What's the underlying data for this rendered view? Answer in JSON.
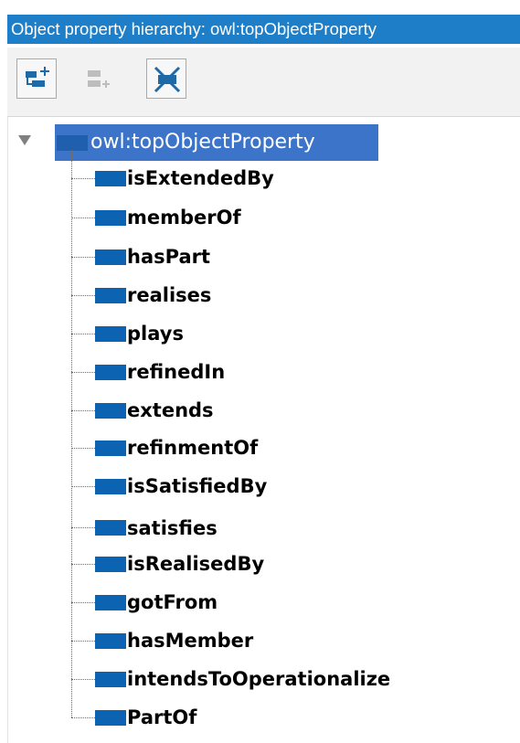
{
  "window": {
    "title": "Object property hierarchy: owl:topObjectProperty"
  },
  "toolbar": {
    "buttons": [
      {
        "icon": "add-sub-property-icon",
        "enabled": true
      },
      {
        "icon": "add-sibling-property-icon",
        "enabled": false
      },
      {
        "icon": "delete-property-icon",
        "enabled": true
      }
    ]
  },
  "tree": {
    "root": {
      "label": "owl:topObjectProperty",
      "expanded": true,
      "selected": true
    },
    "children": [
      {
        "label": "isExtendedBy"
      },
      {
        "label": "memberOf"
      },
      {
        "label": "hasPart"
      },
      {
        "label": "realises"
      },
      {
        "label": "plays"
      },
      {
        "label": "refinedIn"
      },
      {
        "label": "extends"
      },
      {
        "label": "refinmentOf"
      },
      {
        "label": "isSatisfiedBy"
      },
      {
        "label": "satisfies"
      },
      {
        "label": "isRealisedBy"
      },
      {
        "label": "gotFrom"
      },
      {
        "label": "hasMember"
      },
      {
        "label": "intendsToOperationalize"
      },
      {
        "label": "PartOf"
      }
    ]
  },
  "colors": {
    "title_bar": "#1e7fc8",
    "selection": "#3b74c9",
    "property_icon": "#0b63b2",
    "toolbar_bg": "#f2f2f2"
  }
}
